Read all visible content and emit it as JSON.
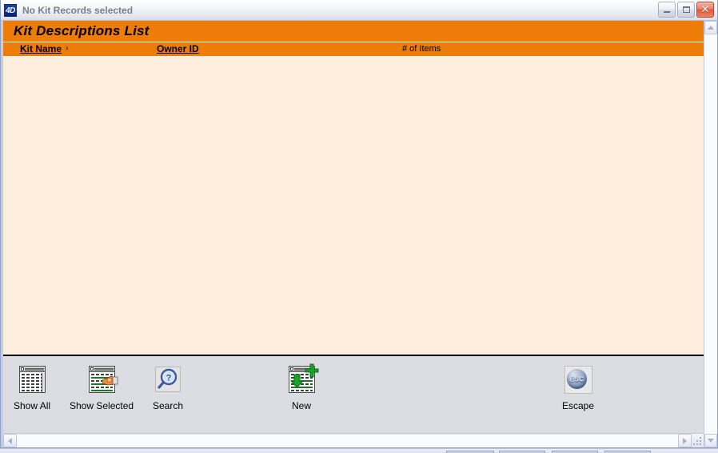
{
  "window": {
    "app_icon_label": "4D",
    "title": "No Kit Records selected",
    "controls": {
      "minimize_label": "Minimize",
      "maximize_label": "Maximize",
      "close_label": "Close"
    }
  },
  "list": {
    "title": "Kit Descriptions List",
    "header_bg": "#ED7D08",
    "body_bg": "#FDEEDD",
    "columns": [
      {
        "label": "Kit Name",
        "sortable": true,
        "sort_indicator": "›"
      },
      {
        "label": "Owner ID",
        "sortable": true
      },
      {
        "label": "# of Items",
        "sortable": false
      }
    ],
    "rows": [],
    "empty_message": ""
  },
  "toolbar": {
    "buttons": [
      {
        "label": "Show All",
        "icon": "list-window-icon"
      },
      {
        "label": "Show Selected",
        "icon": "list-selected-hand-icon"
      },
      {
        "label": "Search",
        "icon": "magnifier-question-icon"
      },
      {
        "label": "New",
        "icon": "new-record-plus-icon"
      },
      {
        "label": "Escape",
        "icon": "esc-sphere-icon",
        "icon_text": "ESC"
      }
    ]
  },
  "scrollbars": {
    "vertical": {
      "up_label": "Scroll up",
      "down_label": "Scroll down"
    },
    "horizontal": {
      "left_label": "Scroll left",
      "right_label": "Scroll right"
    }
  }
}
